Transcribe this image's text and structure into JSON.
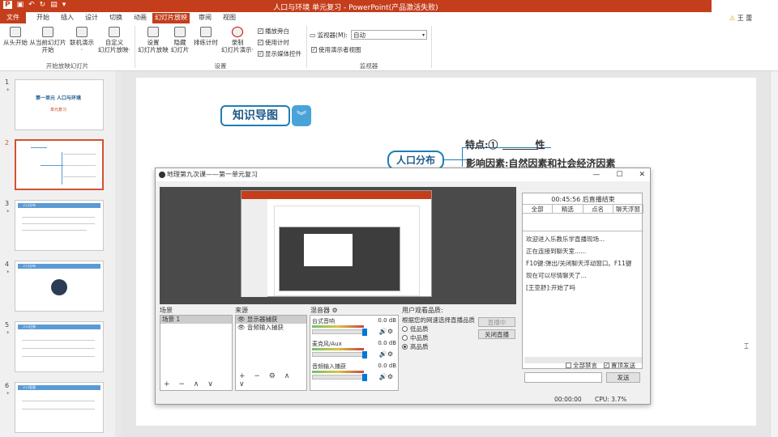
{
  "app": {
    "title": "人口与环境 单元复习 - PowerPoint(产品激活失败)",
    "user": "王 蕾"
  },
  "tabs": [
    "文件",
    "开始",
    "插入",
    "设计",
    "切换",
    "动画",
    "幻灯片放映",
    "审阅",
    "视图"
  ],
  "ribbon": {
    "start": {
      "buttons": [
        "从头开始",
        "从当前幻灯片\n开始",
        "联机演示\n·",
        "自定义\n幻灯片放映·"
      ],
      "label": "开始放映幻灯片"
    },
    "setup": {
      "buttons": [
        "设置\n幻灯片放映",
        "隐藏\n幻灯片",
        "排练计时",
        "录制\n幻灯片演示·"
      ],
      "checkboxes": [
        "播放旁白",
        "使用计时",
        "显示媒体控件"
      ],
      "label": "设置"
    },
    "monitor": {
      "monitor_label": "监视器(M):",
      "monitor_value": "自动",
      "presenter_view": "使用演示者视图",
      "label": "监视器"
    }
  },
  "thumbnails": [
    {
      "num": "1",
      "title": "第一单元  人口与环境",
      "subtitle": "单元复习"
    },
    {
      "num": "2"
    },
    {
      "num": "3",
      "tag": "人口分布"
    },
    {
      "num": "4",
      "tag": "人口分布"
    },
    {
      "num": "5",
      "tag": "人口迁移"
    },
    {
      "num": "6",
      "tag": "人口容量"
    }
  ],
  "slide": {
    "title": "知识导图",
    "node": "人口分布",
    "feature": "特点:①",
    "feature_tail": "性",
    "factors": "影响因素:自然因素和社会经济因素"
  },
  "obs": {
    "title": "地理第九次课——第一单元复习",
    "scenes_label": "场景",
    "scene_items": [
      "场景 1"
    ],
    "sources_label": "来源",
    "source_items": [
      "显示器捕获",
      "音频输入捕获"
    ],
    "mixer_label": "混音器",
    "mixer": [
      {
        "name": "台式音响",
        "db": "0.0 dB"
      },
      {
        "name": "麦克风/Aux",
        "db": "0.0 dB"
      },
      {
        "name": "音频输入捕获",
        "db": "0.0 dB"
      }
    ],
    "quality_label": "用户观看品质:",
    "quality_hint": "根据您的网速选择直播品质",
    "quality": [
      "低品质",
      "中品质",
      "高品质"
    ],
    "btn_live": "直播中",
    "btn_stop": "关闭直播",
    "chat_timer": "00:45:56 后直播结束",
    "chat_tabs": [
      "全部",
      "精选",
      "点名",
      "聊天浮窗"
    ],
    "chat_lines": [
      "欢迎进入乐教乐学直播现场...",
      "正在连接到聊天室......",
      "F10键:弹出/关闭聊天浮动窗口。F11键",
      "现在可以尽情聊天了...",
      "[王亚舒]:开始了吗"
    ],
    "mute_all": "全部禁言",
    "pin": "置顶发送",
    "send": "发送",
    "time": "00:00:00",
    "cpu": "CPU: 3.7%"
  }
}
